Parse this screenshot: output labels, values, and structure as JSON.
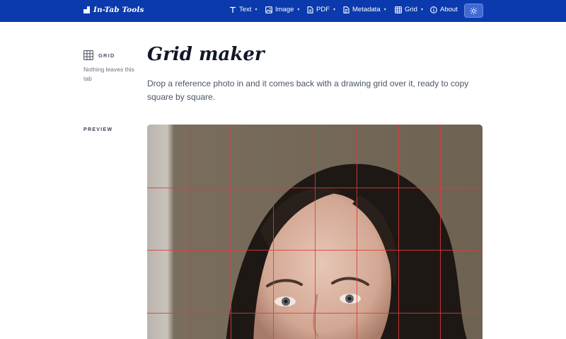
{
  "header": {
    "brand": "In-Tab Tools",
    "nav": [
      {
        "label": "Text",
        "icon": "text-icon",
        "has_menu": true
      },
      {
        "label": "Image",
        "icon": "image-icon",
        "has_menu": true
      },
      {
        "label": "PDF",
        "icon": "document-icon",
        "has_menu": true
      },
      {
        "label": "Metadata",
        "icon": "file-info-icon",
        "has_menu": true
      },
      {
        "label": "Grid",
        "icon": "grid-icon",
        "has_menu": true
      },
      {
        "label": "About",
        "icon": "info-icon",
        "has_menu": false
      }
    ],
    "theme_toggle_icon": "sun-icon"
  },
  "sidebar": {
    "tool_label": "GRID",
    "note": "Nothing leaves this tab",
    "section_label": "PREVIEW"
  },
  "main": {
    "title": "Grid maker",
    "description": "Drop a reference photo in and it comes back with a drawing grid over it, ready to copy square by square."
  },
  "colors": {
    "header_bg": "#0a3aad",
    "accent_button": "#3f69d4",
    "grid_line": "#e03a3a"
  }
}
